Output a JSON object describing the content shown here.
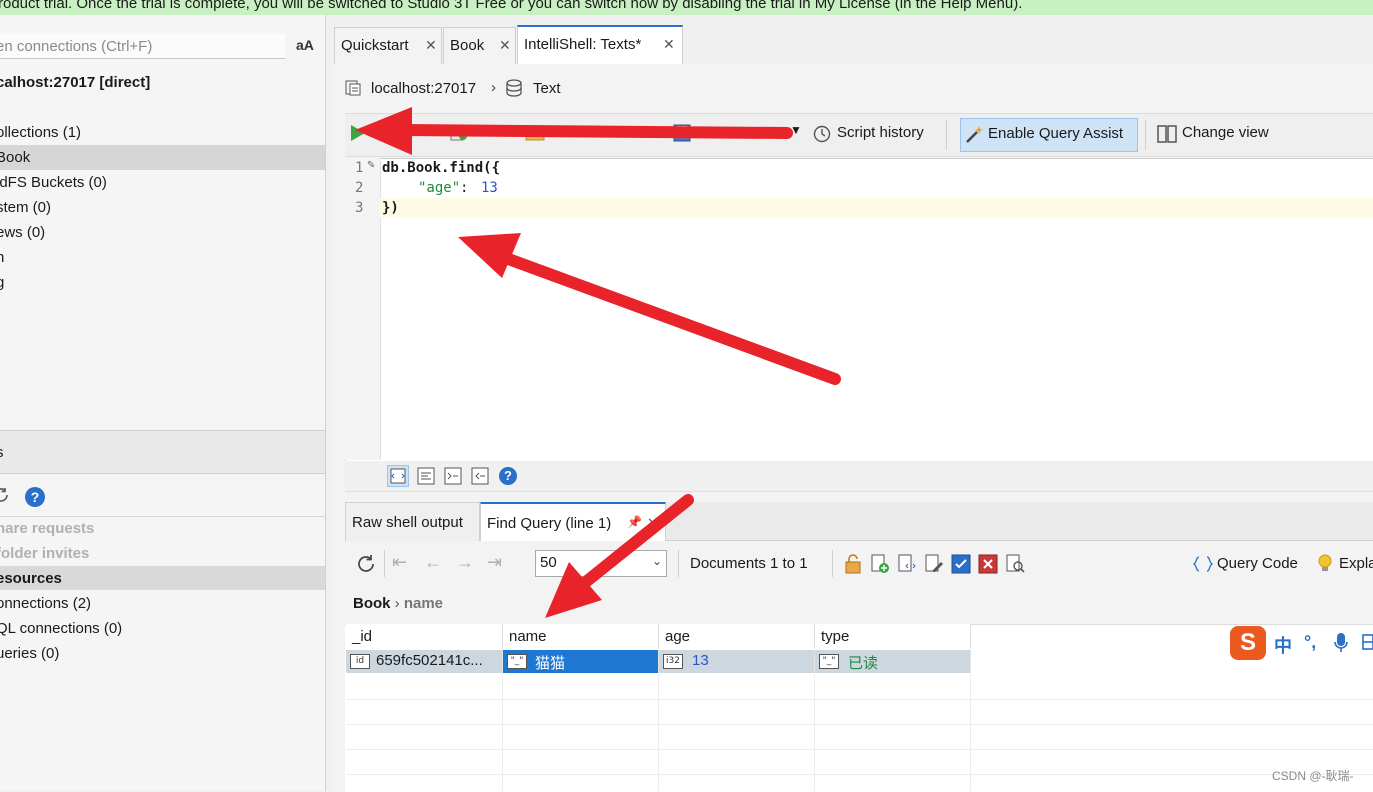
{
  "banner": {
    "text": "roduct trial. Once the trial is complete, you will be switched to Studio 3T Free or you can switch now by disabling the trial in My License (in the Help Menu)."
  },
  "left": {
    "search_placeholder": "en connections (Ctrl+F)",
    "aa_label": "aA",
    "connection_title": "calhost:27017 [direct]",
    "tree": [
      {
        "label": "ollections (1)",
        "selected": false
      },
      {
        "label": "Book",
        "selected": true
      },
      {
        "label": "idFS Buckets (0)",
        "selected": false
      },
      {
        "label": "stem (0)",
        "selected": false
      },
      {
        "label": "ews (0)",
        "selected": false
      },
      {
        "label": "n",
        "selected": false
      },
      {
        "label": "g",
        "selected": false
      }
    ],
    "section2_label": "s",
    "share_requests": "hare requests",
    "folder_invites": "folder invites",
    "resources_header": "esources",
    "resources": [
      "onnections (2)",
      "QL connections (0)",
      "ueries (0)"
    ]
  },
  "tabs": [
    {
      "label": "Quickstart",
      "active": false
    },
    {
      "label": "Book",
      "active": false
    },
    {
      "label": "IntelliShell: Texts*",
      "active": true
    }
  ],
  "breadcrumb": {
    "host": "localhost:27017",
    "db": "Text"
  },
  "toolbar": {
    "script_history": "Script history",
    "enable_query_assist": "Enable Query Assist",
    "change_view": "Change view"
  },
  "editor": {
    "line_numbers": [
      "1",
      "2",
      "3"
    ],
    "lines": {
      "l1": "db.Book.find({",
      "l2_key": "\"age\"",
      "l2_colon": ": ",
      "l2_value": "13",
      "l3": "})"
    }
  },
  "results": {
    "tabs": [
      {
        "label": "Raw shell output",
        "active": false
      },
      {
        "label": "Find Query (line 1)",
        "active": true
      }
    ],
    "page_size": "50",
    "documents_label": "Documents 1 to 1",
    "query_code": "Query Code",
    "explain": "Expla",
    "path_collection": "Book",
    "path_field": "name",
    "columns": [
      "_id",
      "name",
      "age",
      "type"
    ],
    "row": {
      "id": "659fc502141c...",
      "name": "猫猫",
      "age": "13",
      "type": "已读"
    },
    "type_icons": {
      "id": "id",
      "name": "\"_\"",
      "age": "i32",
      "type": "\"_\""
    }
  },
  "ime": {
    "zh": "中",
    "punct": "°,",
    "logo": "S"
  },
  "watermark": "CSDN @-耿瑞-",
  "colors": {
    "accent": "#2a6fc9",
    "selection": "#1e78d2",
    "arrow": "#e8232a",
    "run": "#3aa541"
  }
}
